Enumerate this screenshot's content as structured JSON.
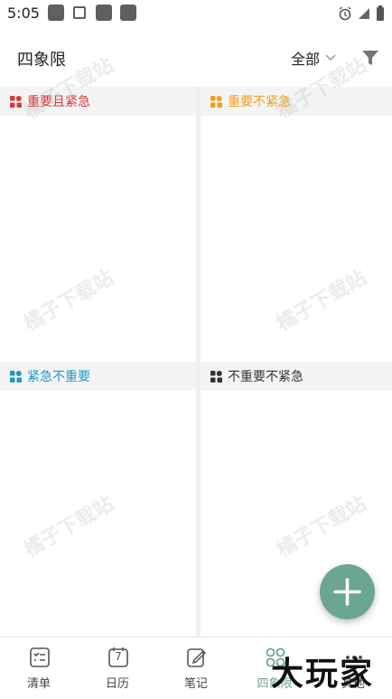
{
  "status_bar": {
    "time": "5:05"
  },
  "header": {
    "title": "四象限",
    "filter_label": "全部"
  },
  "quadrants": [
    {
      "label": "重要且紧急",
      "color": "#d83a3a"
    },
    {
      "label": "重要不紧急",
      "color": "#f0a020"
    },
    {
      "label": "紧急不重要",
      "color": "#1a9bc8"
    },
    {
      "label": "不重要不紧急",
      "color": "#333333"
    }
  ],
  "watermark": "橘子下载站",
  "nav": {
    "items": [
      {
        "label": "清单",
        "icon": "checklist-icon"
      },
      {
        "label": "日历",
        "icon": "calendar-icon",
        "day": "7"
      },
      {
        "label": "笔记",
        "icon": "note-icon"
      },
      {
        "label": "四象限",
        "icon": "quadrant-icon"
      },
      {
        "label": "其他",
        "icon": "more-icon"
      }
    ]
  },
  "overlay_logo": "大玩家",
  "accent_color": "#6aa690"
}
